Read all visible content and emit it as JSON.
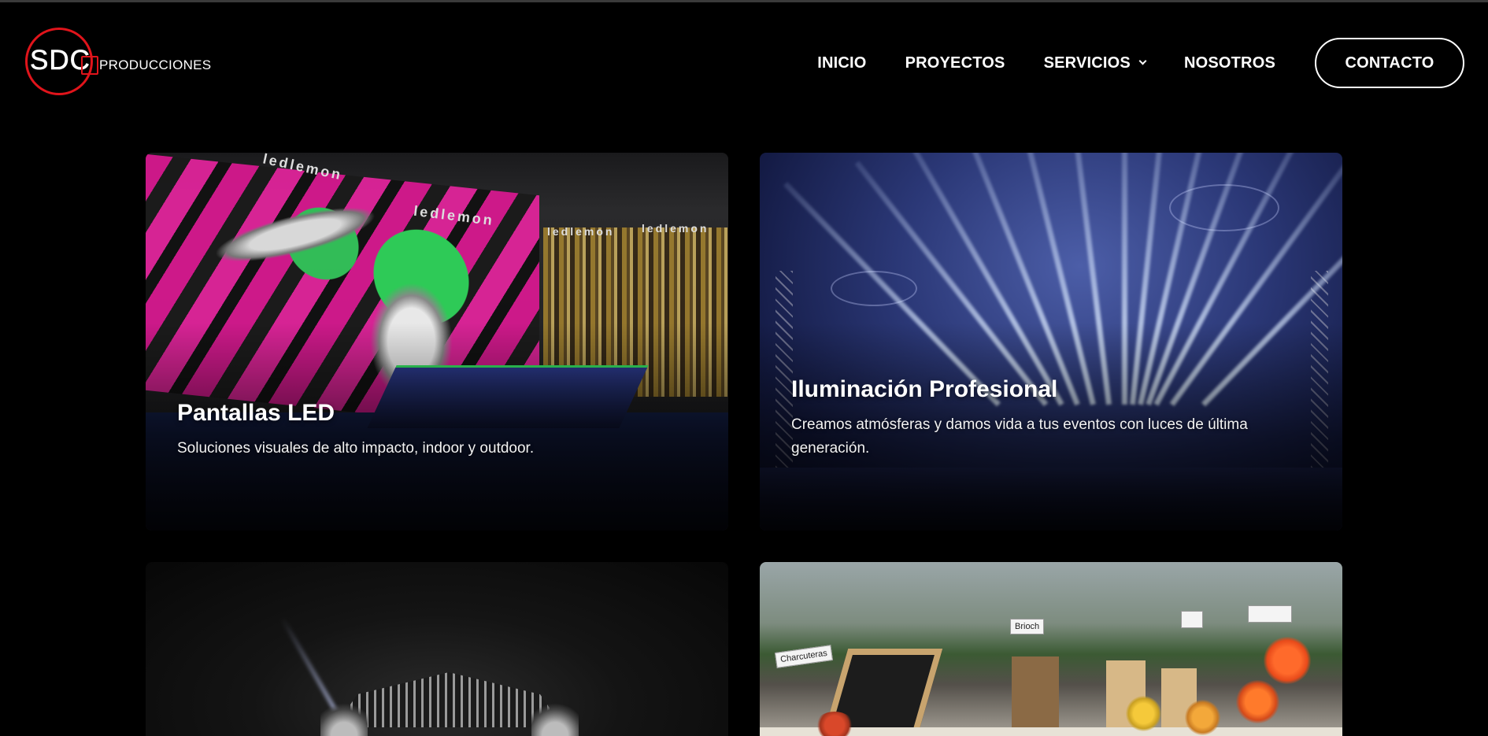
{
  "brand": {
    "logo_main": "SDC",
    "logo_sub": "PRODUCCIONES"
  },
  "nav": {
    "items": [
      {
        "label": "INICIO"
      },
      {
        "label": "PROYECTOS"
      },
      {
        "label": "SERVICIOS",
        "has_dropdown": true
      },
      {
        "label": "NOSOTROS"
      }
    ],
    "contact_label": "CONTACTO"
  },
  "services": [
    {
      "title": "Pantallas LED",
      "description": "Soluciones visuales de alto impacto, indoor y outdoor.",
      "image_text": "ledlemon"
    },
    {
      "title": "Iluminación Profesional",
      "description": "Creamos atmósferas y damos vida a tus eventos con luces de última generación."
    },
    {
      "title": "",
      "description": ""
    },
    {
      "title": "",
      "description": "",
      "sign_1": "Charcuteras",
      "sign_2": "Brioch"
    }
  ],
  "colors": {
    "background": "#000000",
    "text": "#ffffff",
    "brand_red": "#e0141b"
  },
  "icons": {
    "dropdown": "chevron-down-icon"
  }
}
